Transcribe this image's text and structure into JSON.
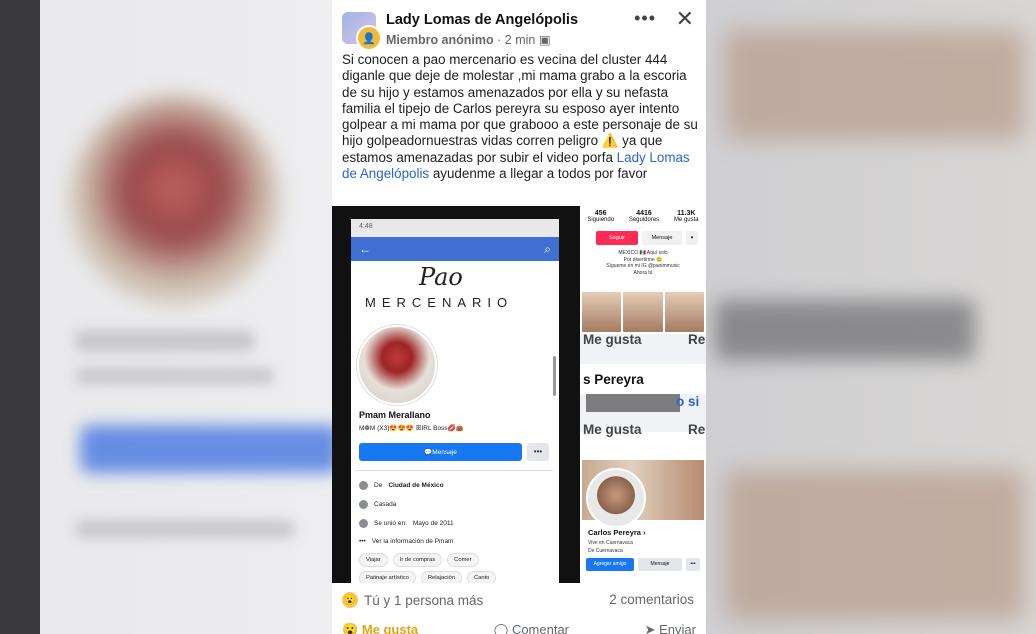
{
  "post": {
    "group_name": "Lady Lomas de Angelópolis",
    "author": "Miembro anónimo",
    "time": "2 min",
    "more": "•••",
    "close": "✕",
    "text_before_link": "Si conocen a pao mercenario es vecina del cluster 444 diganle que deje de molestar ,mi mama grabo a la escoria de su hijo y estamos amenazados  por ella y su nefasta familia el tipejo de Carlos pereyra su esposo ayer intento golpear a mi mama por que grabooo a este personaje de su hijo golpeadornuestras vidas corren peligro ⚠️ ya que estamos amenazadas por subir el video porfa ",
    "link_text": "Lady Lomas de Angelópolis",
    "text_after_link": " ayudenme a llegar a todos por favor",
    "reactions": "Tú y 1 persona más",
    "comments": "2 comentarios",
    "actions": [
      "Me gusta",
      "Comentar",
      "Enviar"
    ]
  },
  "left_screenshot": {
    "status_time": "4:48",
    "cover_script": "Pao",
    "cover_word": "MERCENARIO",
    "profile_name": "Pmam Merallano",
    "bio": "M❁M (X3)😍😍😍   ꕥIRL Bᴏss💋👜",
    "message_button": "Mensaje",
    "more": "•••",
    "info": [
      {
        "prefix": "De ",
        "value": "Ciudad de México"
      },
      {
        "prefix": "",
        "value": "Casada"
      },
      {
        "prefix": "Se unió en: ",
        "value": "Mayo de 2011"
      },
      {
        "prefix": "",
        "value": "Ver la información de Pmam"
      }
    ],
    "chips_row1": [
      "Viajar",
      "Ir de compras",
      "Comer"
    ],
    "chips_row2": [
      "Patinaje artístico",
      "Relajación",
      "Canto"
    ]
  },
  "right_screenshot": {
    "stats": [
      {
        "value": "456",
        "label": "Siguiendo"
      },
      {
        "value": "4416",
        "label": "Seguidores"
      },
      {
        "value": "11.3K",
        "label": "Me gusta"
      }
    ],
    "follow": "Seguir",
    "message": "Mensaje",
    "bio_lines": [
      "MEXICO 🇲🇽 Aquí solo",
      "Por divertirme 😊",
      "Sígueme en mi IG @paoimmusic",
      "Ahora tú"
    ],
    "like1": "Me gusta",
    "re1": "Re",
    "name_partial": "s Pereyra",
    "si": "o si",
    "like2": "Me gusta",
    "re2": "Re",
    "cp_name": "Carlos Pereyra",
    "cp_lines": [
      "Vive en Cuernavaca",
      "De Cuernavaca"
    ],
    "add_friend": "Agregar amigo",
    "cp_message": "Mensaje",
    "cp_more": "•••"
  }
}
